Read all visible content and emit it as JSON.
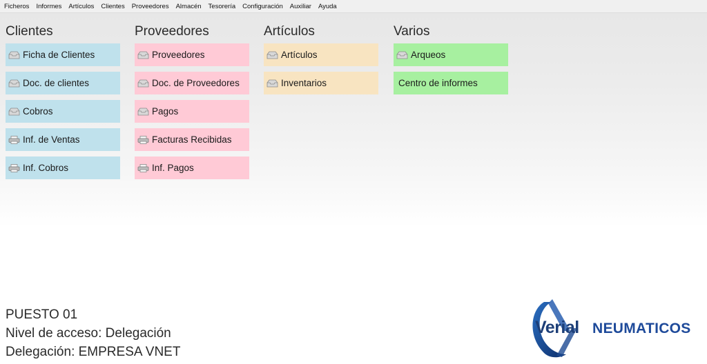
{
  "menu": [
    "Ficheros",
    "Informes",
    "Artículos",
    "Clientes",
    "Proveedores",
    "Almacén",
    "Tesorería",
    "Configuración",
    "Auxiliar",
    "Ayuda"
  ],
  "colors": {
    "clientes": "#bfe1ec",
    "proveedores": "#ffcad6",
    "articulos": "#f8e4c1",
    "varios": "#a7f0a0"
  },
  "columns": [
    {
      "title": "Clientes",
      "items": [
        {
          "label": "Ficha de Clientes",
          "icon": "tray-icon"
        },
        {
          "label": "Doc. de clientes",
          "icon": "tray-icon"
        },
        {
          "label": "Cobros",
          "icon": "tray-icon"
        },
        {
          "label": "Inf. de Ventas",
          "icon": "printer-icon"
        },
        {
          "label": "Inf. Cobros",
          "icon": "printer-icon"
        }
      ]
    },
    {
      "title": "Proveedores",
      "items": [
        {
          "label": "Proveedores",
          "icon": "tray-icon"
        },
        {
          "label": "Doc. de Proveedores",
          "icon": "tray-icon"
        },
        {
          "label": "Pagos",
          "icon": "tray-icon"
        },
        {
          "label": "Facturas Recibidas",
          "icon": "printer-icon"
        },
        {
          "label": "Inf. Pagos",
          "icon": "printer-icon"
        }
      ]
    },
    {
      "title": "Artículos",
      "items": [
        {
          "label": "Artículos",
          "icon": "tray-icon"
        },
        {
          "label": "Inventarios",
          "icon": "tray-icon"
        }
      ]
    },
    {
      "title": "Varios",
      "items": [
        {
          "label": "Arqueos",
          "icon": "tray-icon"
        },
        {
          "label": "Centro de informes",
          "icon": ""
        }
      ]
    }
  ],
  "info": {
    "puesto": "PUESTO 01",
    "nivel": "Nivel de acceso: Delegación",
    "delegacion": "Delegación: EMPRESA VNET"
  },
  "logo": {
    "brand": "Verial",
    "name": "NEUMATICOS"
  }
}
